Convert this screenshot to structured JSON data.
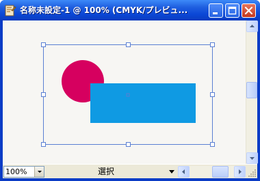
{
  "window": {
    "title": "名称未設定-1 @ 100% (CMYK/プレビュ...",
    "icons": {
      "app": "document-app-icon",
      "minimize": "minimize-icon",
      "maximize": "maximize-icon",
      "close": "close-icon"
    }
  },
  "colors": {
    "titlebar": "#0b47d6",
    "circle_fill": "#d6005f",
    "rectangle_fill": "#0f9ae3",
    "selection": "#5a7fd3",
    "close_button": "#d9552f",
    "canvas": "#f7f6f3"
  },
  "canvas": {
    "objects": [
      {
        "shape": "circle",
        "fill": "#d6005f",
        "selected": true
      },
      {
        "shape": "rectangle",
        "fill": "#0f9ae3",
        "selected": true
      }
    ]
  },
  "statusbar": {
    "zoom": "100%",
    "mode": "選択"
  }
}
